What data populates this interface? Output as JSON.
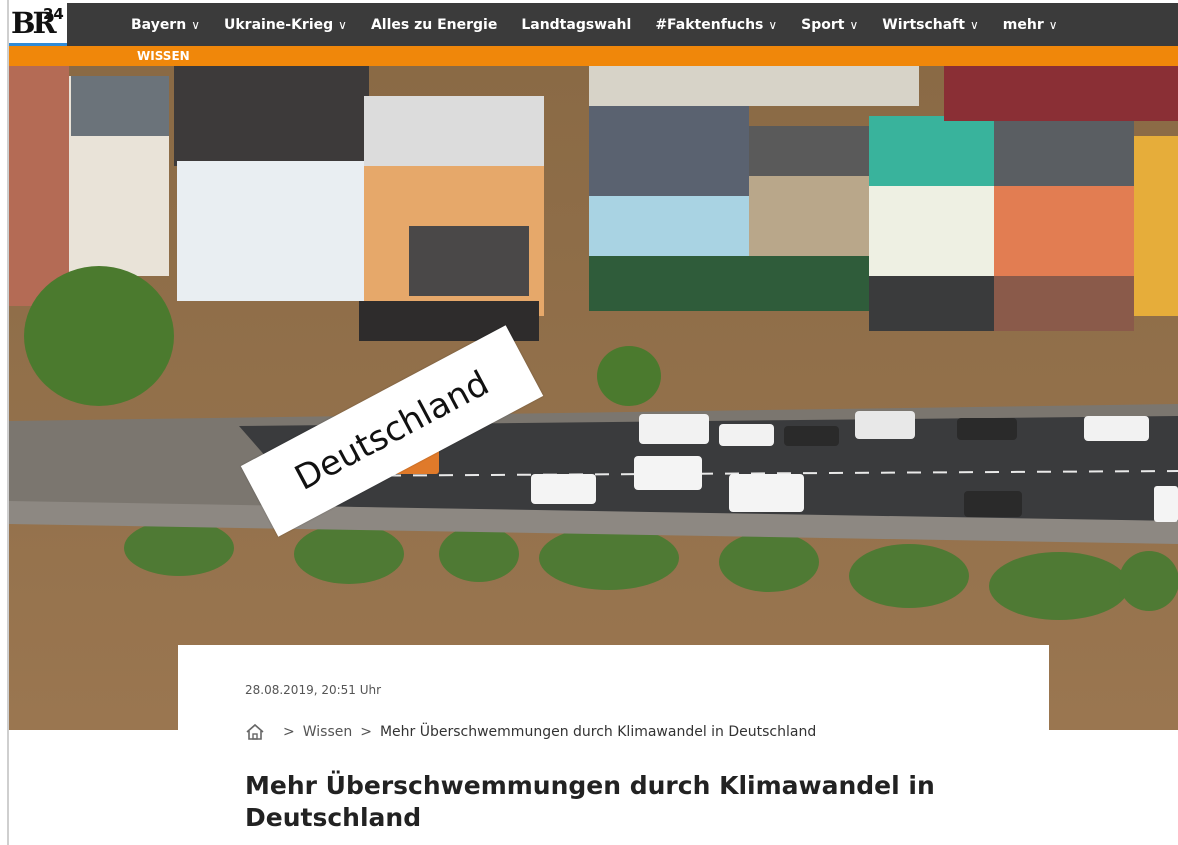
{
  "logo": {
    "text": "BR",
    "superscript": "24"
  },
  "nav": {
    "items": [
      {
        "label": "Bayern",
        "has_dropdown": true
      },
      {
        "label": "Ukraine-Krieg",
        "has_dropdown": true
      },
      {
        "label": "Alles zu Energie",
        "has_dropdown": false
      },
      {
        "label": "Landtagswahl",
        "has_dropdown": false
      },
      {
        "label": "#Faktenfuchs",
        "has_dropdown": true
      },
      {
        "label": "Sport",
        "has_dropdown": true
      },
      {
        "label": "Wirtschaft",
        "has_dropdown": true
      },
      {
        "label": "mehr",
        "has_dropdown": true
      }
    ],
    "chevron": "∨",
    "section": "WISSEN"
  },
  "hero": {
    "overlay_label": "Deutschland"
  },
  "article": {
    "date": "28.08.2019, 20:51 Uhr",
    "breadcrumb": {
      "sep": ">",
      "items": [
        "Wissen",
        "Mehr Überschwemmungen durch Klimawandel in Deutschland"
      ]
    },
    "title": "Mehr Überschwemmungen durch Klimawandel in Deutschland"
  },
  "colors": {
    "nav_bg": "#3b3b3b",
    "accent_orange": "#f0870a",
    "accent_blue": "#2f8bd8",
    "flood_water": "#8b6a43"
  }
}
